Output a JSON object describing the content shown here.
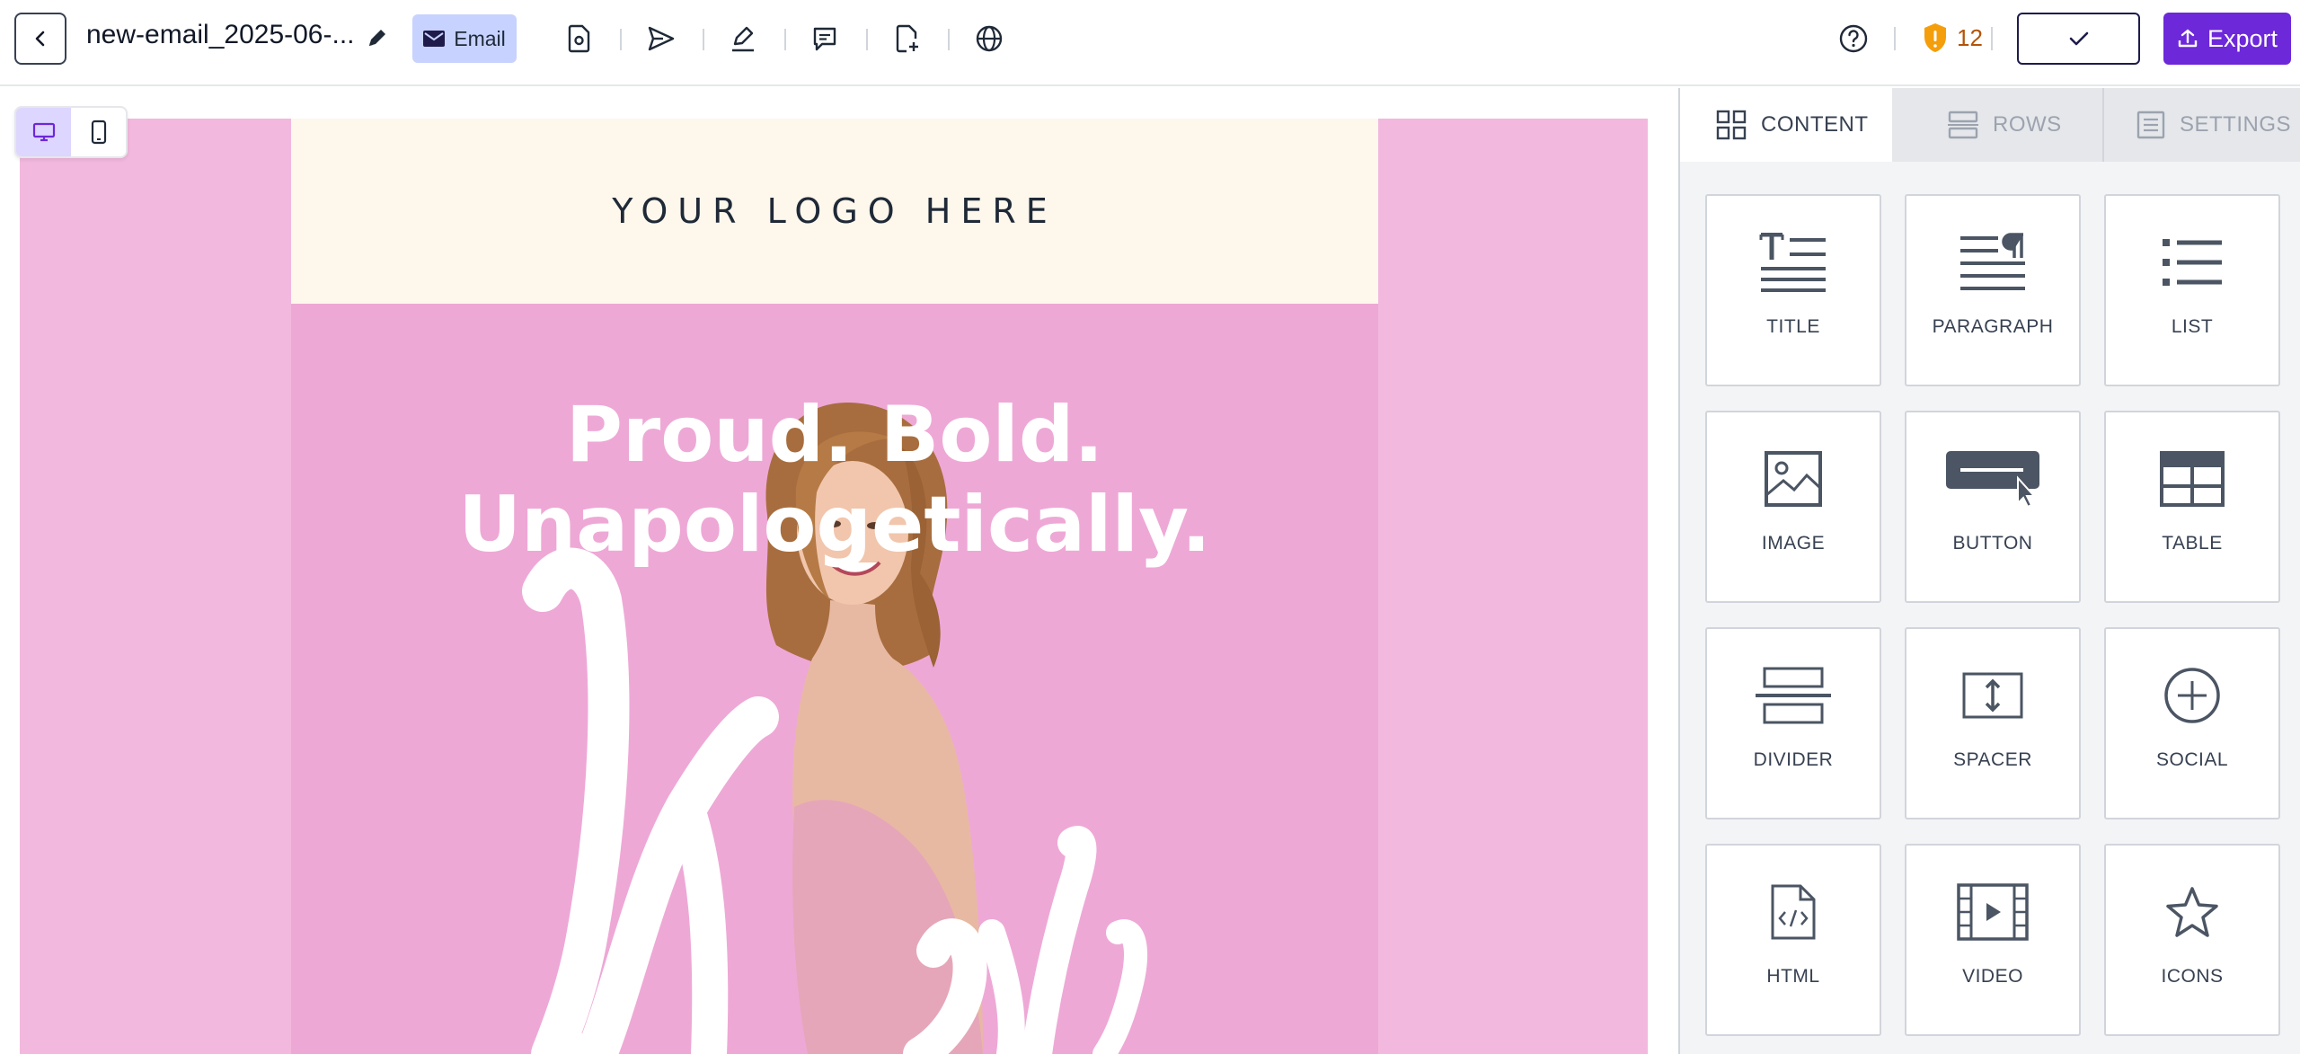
{
  "header": {
    "filename": "new-email_2025-06-...",
    "email_chip_label": "Email",
    "warning_count": "12",
    "export_label": "Export"
  },
  "email": {
    "logo_text": "YOUR LOGO HERE",
    "headline_line1": "Proud. Bold.",
    "headline_line2": "Unapologetically.",
    "script_text": "You"
  },
  "panel": {
    "tabs": [
      {
        "label": "CONTENT",
        "icon": "grid-icon",
        "active": true
      },
      {
        "label": "ROWS",
        "icon": "rows-icon",
        "active": false
      },
      {
        "label": "SETTINGS",
        "icon": "settings-doc-icon",
        "active": false
      }
    ],
    "blocks": [
      {
        "label": "TITLE",
        "icon": "title-icon"
      },
      {
        "label": "PARAGRAPH",
        "icon": "paragraph-icon"
      },
      {
        "label": "LIST",
        "icon": "list-icon"
      },
      {
        "label": "IMAGE",
        "icon": "image-icon"
      },
      {
        "label": "BUTTON",
        "icon": "button-icon"
      },
      {
        "label": "TABLE",
        "icon": "table-icon"
      },
      {
        "label": "DIVIDER",
        "icon": "divider-icon"
      },
      {
        "label": "SPACER",
        "icon": "spacer-icon"
      },
      {
        "label": "SOCIAL",
        "icon": "social-icon"
      },
      {
        "label": "HTML",
        "icon": "html-icon"
      },
      {
        "label": "VIDEO",
        "icon": "video-icon"
      },
      {
        "label": "ICONS",
        "icon": "star-icon"
      }
    ]
  },
  "colors": {
    "accent": "#6d28d9",
    "email_chip": "#c7d2fe",
    "warning": "#f59e0b",
    "outer_pink": "#f2b8dd",
    "hero_pink": "#eea8d6",
    "logo_band": "#fdf7ec"
  }
}
